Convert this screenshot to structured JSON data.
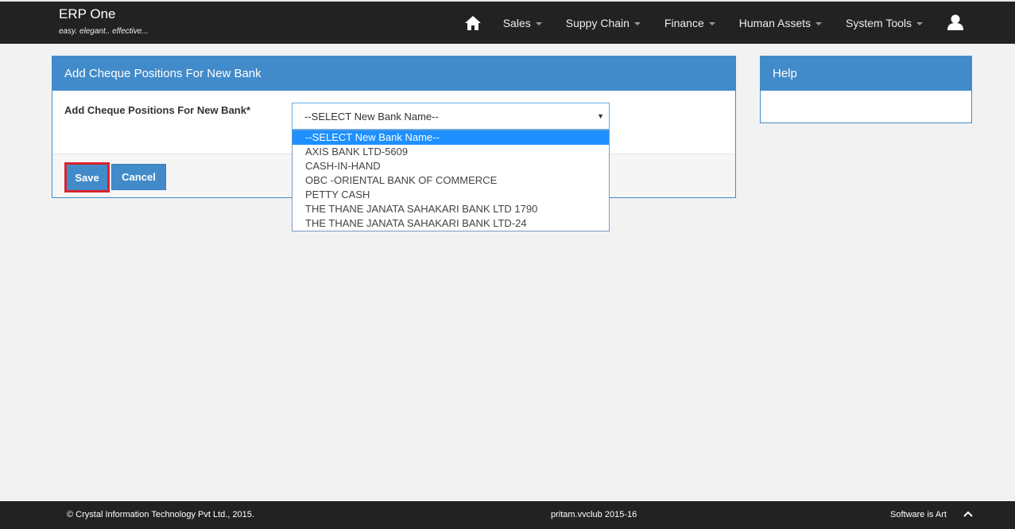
{
  "brand": {
    "title": "ERP One",
    "tagline": "easy. elegant.. effective..."
  },
  "nav": {
    "home_icon": "home-icon",
    "items": [
      {
        "label": "Sales"
      },
      {
        "label": "Suppy Chain"
      },
      {
        "label": "Finance"
      },
      {
        "label": "Human Assets"
      },
      {
        "label": "System Tools"
      }
    ],
    "user_icon": "user-icon"
  },
  "form_panel": {
    "title": "Add Cheque Positions For New Bank",
    "field_label": "Add Cheque Positions For New Bank*",
    "select_value": "--SELECT New Bank Name--",
    "options": [
      "--SELECT New Bank Name--",
      "AXIS BANK LTD-5609",
      "CASH-IN-HAND",
      "OBC -ORIENTAL BANK OF COMMERCE",
      "PETTY CASH",
      "THE THANE JANATA SAHAKARI BANK LTD 1790",
      "THE THANE JANATA SAHAKARI BANK LTD-24"
    ],
    "save_label": "Save",
    "cancel_label": "Cancel"
  },
  "help_panel": {
    "title": "Help"
  },
  "footer": {
    "copyright": "© Crystal Information Technology Pvt Ltd., 2015.",
    "session": "pritam.vvclub 2015-16",
    "slogan": "Software is Art"
  },
  "colors": {
    "accent": "#428bca",
    "topbar": "#222222",
    "highlight": "#d9232d",
    "option_selected": "#1e90ff"
  }
}
